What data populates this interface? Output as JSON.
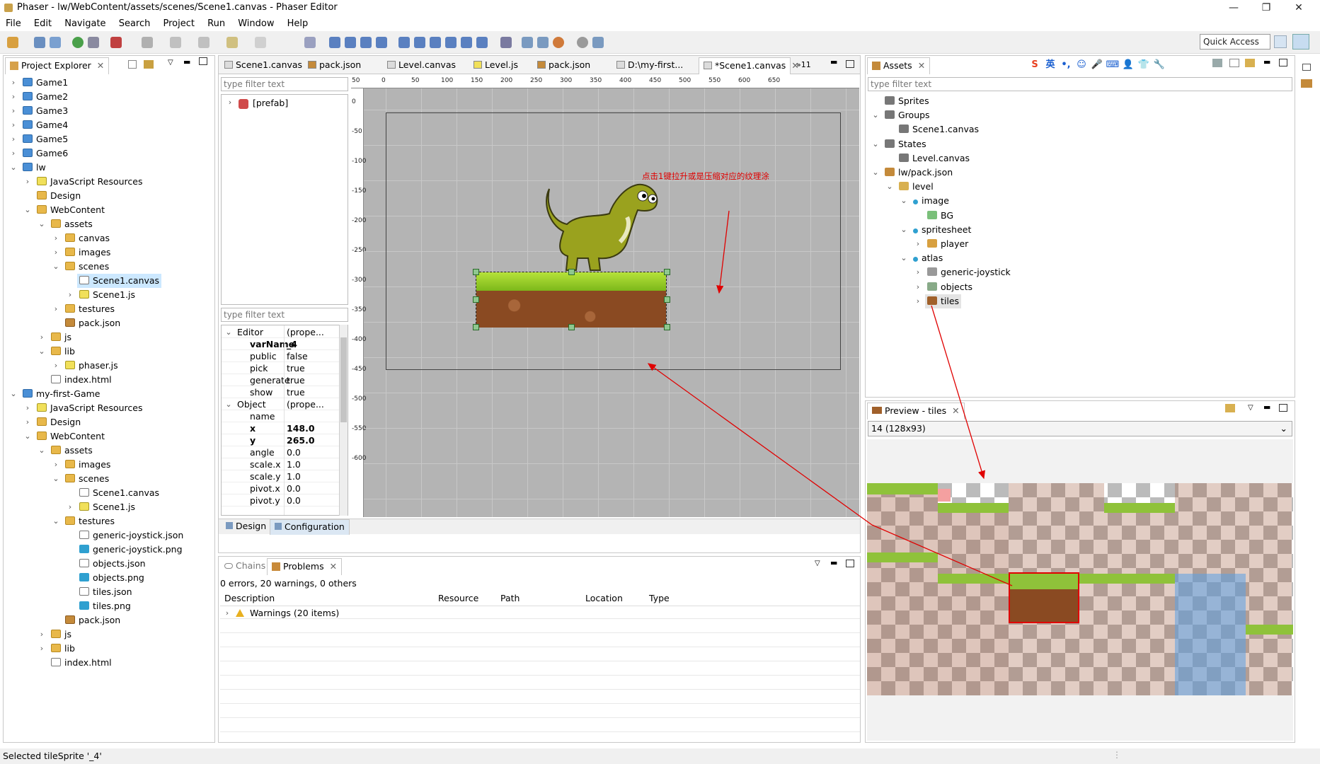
{
  "window": {
    "title": "Phaser - lw/WebContent/assets/scenes/Scene1.canvas - Phaser Editor",
    "minimize": "—",
    "restore": "❐",
    "close": "✕"
  },
  "menu": [
    "File",
    "Edit",
    "Navigate",
    "Search",
    "Project",
    "Run",
    "Window",
    "Help"
  ],
  "quick_access": "Quick Access",
  "project_explorer": {
    "title": "Project Explorer",
    "items": [
      {
        "label": "Game1",
        "depth": 0,
        "chev": "›",
        "icon": "proj"
      },
      {
        "label": "Game2",
        "depth": 0,
        "chev": "›",
        "icon": "proj"
      },
      {
        "label": "Game3",
        "depth": 0,
        "chev": "›",
        "icon": "proj"
      },
      {
        "label": "Game4",
        "depth": 0,
        "chev": "›",
        "icon": "proj"
      },
      {
        "label": "Game5",
        "depth": 0,
        "chev": "›",
        "icon": "proj"
      },
      {
        "label": "Game6",
        "depth": 0,
        "chev": "›",
        "icon": "proj"
      },
      {
        "label": "lw",
        "depth": 0,
        "chev": "⌄",
        "icon": "proj"
      },
      {
        "label": "JavaScript Resources",
        "depth": 1,
        "chev": "›",
        "icon": "jsres"
      },
      {
        "label": "Design",
        "depth": 1,
        "chev": "",
        "icon": "folder"
      },
      {
        "label": "WebContent",
        "depth": 1,
        "chev": "⌄",
        "icon": "folder"
      },
      {
        "label": "assets",
        "depth": 2,
        "chev": "⌄",
        "icon": "folder"
      },
      {
        "label": "canvas",
        "depth": 3,
        "chev": "›",
        "icon": "folder"
      },
      {
        "label": "images",
        "depth": 3,
        "chev": "›",
        "icon": "folder"
      },
      {
        "label": "scenes",
        "depth": 3,
        "chev": "⌄",
        "icon": "folder"
      },
      {
        "label": "Scene1.canvas",
        "depth": 4,
        "chev": "",
        "icon": "canvas",
        "selected": true
      },
      {
        "label": "Scene1.js",
        "depth": 4,
        "chev": "›",
        "icon": "js"
      },
      {
        "label": "testures",
        "depth": 3,
        "chev": "›",
        "icon": "folder"
      },
      {
        "label": "pack.json",
        "depth": 3,
        "chev": "",
        "icon": "pkg"
      },
      {
        "label": "js",
        "depth": 2,
        "chev": "›",
        "icon": "folder"
      },
      {
        "label": "lib",
        "depth": 2,
        "chev": "⌄",
        "icon": "folder"
      },
      {
        "label": "phaser.js",
        "depth": 3,
        "chev": "›",
        "icon": "js"
      },
      {
        "label": "index.html",
        "depth": 2,
        "chev": "",
        "icon": "file"
      },
      {
        "label": "my-first-Game",
        "depth": 0,
        "chev": "⌄",
        "icon": "proj"
      },
      {
        "label": "JavaScript Resources",
        "depth": 1,
        "chev": "›",
        "icon": "jsres"
      },
      {
        "label": "Design",
        "depth": 1,
        "chev": "›",
        "icon": "folder"
      },
      {
        "label": "WebContent",
        "depth": 1,
        "chev": "⌄",
        "icon": "folder"
      },
      {
        "label": "assets",
        "depth": 2,
        "chev": "⌄",
        "icon": "folder"
      },
      {
        "label": "images",
        "depth": 3,
        "chev": "›",
        "icon": "folder"
      },
      {
        "label": "scenes",
        "depth": 3,
        "chev": "⌄",
        "icon": "folder"
      },
      {
        "label": "Scene1.canvas",
        "depth": 4,
        "chev": "",
        "icon": "canvas"
      },
      {
        "label": "Scene1.js",
        "depth": 4,
        "chev": "›",
        "icon": "js"
      },
      {
        "label": "testures",
        "depth": 3,
        "chev": "⌄",
        "icon": "folder"
      },
      {
        "label": "generic-joystick.json",
        "depth": 4,
        "chev": "",
        "icon": "file"
      },
      {
        "label": "generic-joystick.png",
        "depth": 4,
        "chev": "",
        "icon": "img"
      },
      {
        "label": "objects.json",
        "depth": 4,
        "chev": "",
        "icon": "file"
      },
      {
        "label": "objects.png",
        "depth": 4,
        "chev": "",
        "icon": "img"
      },
      {
        "label": "tiles.json",
        "depth": 4,
        "chev": "",
        "icon": "file"
      },
      {
        "label": "tiles.png",
        "depth": 4,
        "chev": "",
        "icon": "img"
      },
      {
        "label": "pack.json",
        "depth": 3,
        "chev": "",
        "icon": "pkg"
      },
      {
        "label": "js",
        "depth": 2,
        "chev": "›",
        "icon": "folder"
      },
      {
        "label": "lib",
        "depth": 2,
        "chev": "›",
        "icon": "folder"
      },
      {
        "label": "index.html",
        "depth": 2,
        "chev": "",
        "icon": "file"
      }
    ]
  },
  "editor_tabs": [
    {
      "label": "Scene1.canvas"
    },
    {
      "label": "pack.json"
    },
    {
      "label": "Level.canvas"
    },
    {
      "label": "Level.js"
    },
    {
      "label": "pack.json"
    },
    {
      "label": "D:\\my-first..."
    },
    {
      "label": "*Scene1.canvas",
      "active": true
    }
  ],
  "editor_tabs_overflow": "»11",
  "outline": {
    "filter_placeholder": "type filter text",
    "root": "[prefab]"
  },
  "properties": {
    "filter_placeholder": "type filter text",
    "rows": [
      {
        "key": "Editor",
        "value": "(prope...",
        "section": true
      },
      {
        "key": "varName",
        "value": "_4",
        "bold": true
      },
      {
        "key": "public",
        "value": "false"
      },
      {
        "key": "pick",
        "value": "true"
      },
      {
        "key": "generate",
        "value": "true"
      },
      {
        "key": "show",
        "value": "true"
      },
      {
        "key": "Object",
        "value": "(prope...",
        "section": true
      },
      {
        "key": "name",
        "value": ""
      },
      {
        "key": "x",
        "value": "148.0",
        "bold": true
      },
      {
        "key": "y",
        "value": "265.0",
        "bold": true
      },
      {
        "key": "angle",
        "value": "0.0"
      },
      {
        "key": "scale.x",
        "value": "1.0"
      },
      {
        "key": "scale.y",
        "value": "1.0"
      },
      {
        "key": "pivot.x",
        "value": "0.0"
      },
      {
        "key": "pivot.y",
        "value": "0.0"
      }
    ]
  },
  "editor_bottom_tabs": {
    "design": "Design",
    "configuration": "Configuration"
  },
  "ruler_h": [
    "50",
    "0",
    "50",
    "100",
    "150",
    "200",
    "250",
    "300",
    "350",
    "400",
    "450",
    "500",
    "550",
    "600",
    "650"
  ],
  "ruler_v": [
    "0",
    "-50",
    "-100",
    "-150",
    "-200",
    "-250",
    "-300",
    "-350",
    "-400",
    "-450",
    "-500",
    "-550",
    "-600"
  ],
  "annotation": "点击1键拉升或是压缩对应的纹理涂",
  "problems": {
    "chains_tab": "Chains",
    "problems_tab": "Problems",
    "summary": "0 errors, 20 warnings, 0 others",
    "columns": [
      "Description",
      "Resource",
      "Path",
      "Location",
      "Type"
    ],
    "rows": [
      {
        "description": "Warnings (20 items)"
      }
    ]
  },
  "assets": {
    "title": "Assets",
    "filter_placeholder": "type filter text",
    "items": [
      {
        "label": "Sprites",
        "depth": 0,
        "chev": ""
      },
      {
        "label": "Groups",
        "depth": 0,
        "chev": "⌄"
      },
      {
        "label": "Scene1.canvas",
        "depth": 1,
        "chev": ""
      },
      {
        "label": "States",
        "depth": 0,
        "chev": "⌄"
      },
      {
        "label": "Level.canvas",
        "depth": 1,
        "chev": ""
      },
      {
        "label": "lw/pack.json",
        "depth": 0,
        "chev": "⌄"
      },
      {
        "label": "level",
        "depth": 1,
        "chev": "⌄"
      },
      {
        "label": "image",
        "depth": 2,
        "chev": "⌄"
      },
      {
        "label": "BG",
        "depth": 3,
        "chev": ""
      },
      {
        "label": "spritesheet",
        "depth": 2,
        "chev": "⌄"
      },
      {
        "label": "player",
        "depth": 3,
        "chev": "›"
      },
      {
        "label": "atlas",
        "depth": 2,
        "chev": "⌄"
      },
      {
        "label": "generic-joystick",
        "depth": 3,
        "chev": "›"
      },
      {
        "label": "objects",
        "depth": 3,
        "chev": "›"
      },
      {
        "label": "tiles",
        "depth": 3,
        "chev": "›",
        "selected": true
      }
    ]
  },
  "ime_toolbar": [
    "S",
    "英",
    "•,",
    "☺",
    "🎤",
    "⌨",
    "👤",
    "👕",
    "🔧"
  ],
  "preview": {
    "title": "Preview - tiles",
    "frame_select": "14 (128x93)"
  },
  "status": "Selected tileSprite '_4'",
  "colors": {
    "accent": "#2f7ed8",
    "canvas_bg": "#b4b4b4",
    "selection": "#cce8ff",
    "arrow": "#e00000"
  }
}
